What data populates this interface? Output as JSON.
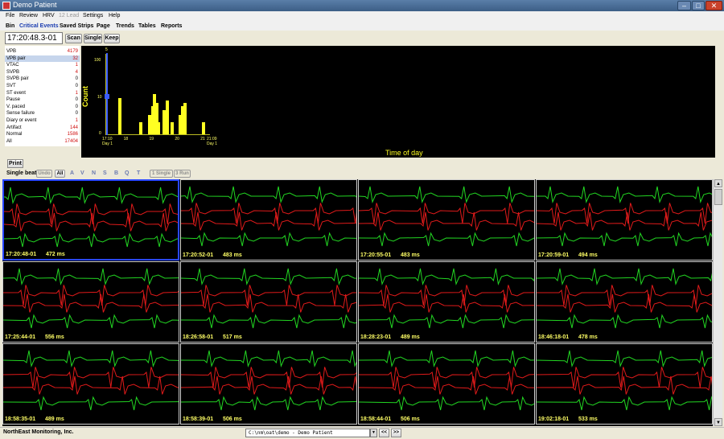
{
  "window": {
    "title": "Demo Patient"
  },
  "menu": [
    {
      "label": "File",
      "disabled": false
    },
    {
      "label": "Review",
      "disabled": false
    },
    {
      "label": "HRV",
      "disabled": false
    },
    {
      "label": "12 Lead",
      "disabled": true
    },
    {
      "label": "Settings",
      "disabled": false
    },
    {
      "label": "Help",
      "disabled": false
    }
  ],
  "tabs": [
    {
      "label": "Bin",
      "active": false
    },
    {
      "label": "Critical Events",
      "active": true
    },
    {
      "label": "Saved Strips",
      "active": false
    },
    {
      "label": "Page",
      "active": false
    },
    {
      "label": "Trends",
      "active": false
    },
    {
      "label": "Tables",
      "active": false
    },
    {
      "label": "Reports",
      "active": false
    }
  ],
  "toolbar": {
    "time_value": "17:20:48.3-01",
    "scan_label": "Scan",
    "single_label": "Single",
    "keep_label": "Keep"
  },
  "events": [
    {
      "label": "VPB",
      "count": "4179",
      "selected": false
    },
    {
      "label": "VPB pair",
      "count": "32",
      "selected": true
    },
    {
      "label": "VTAC",
      "count": "1",
      "selected": false
    },
    {
      "label": "SVPB",
      "count": "4",
      "selected": false
    },
    {
      "label": "SVPB pair",
      "count": "0",
      "selected": false
    },
    {
      "label": "SVT",
      "count": "0",
      "selected": false
    },
    {
      "label": "ST event",
      "count": "1",
      "selected": false
    },
    {
      "label": "Pause",
      "count": "0",
      "selected": false
    },
    {
      "label": "V. paced",
      "count": "0",
      "selected": false
    },
    {
      "label": "Sense failure",
      "count": "0",
      "selected": false
    },
    {
      "label": "Diary or event",
      "count": "1",
      "selected": false
    },
    {
      "label": "Artifact",
      "count": "144",
      "selected": false
    },
    {
      "label": "Normal",
      "count": "1586",
      "selected": false
    },
    {
      "label": "All",
      "count": "17404",
      "selected": false
    }
  ],
  "chart_data": {
    "type": "bar",
    "title": "",
    "xlabel": "Time of day",
    "ylabel": "Count",
    "marker_label": "5",
    "y_ticks": [
      "100",
      "10",
      "0"
    ],
    "x_ticks": [
      {
        "label": "17:10",
        "sub": "Day 1",
        "at": 0.0
      },
      {
        "label": "18",
        "sub": "",
        "at": 0.205
      },
      {
        "label": "19",
        "sub": "",
        "at": 0.45
      },
      {
        "label": "20",
        "sub": "",
        "at": 0.695
      },
      {
        "label": "21",
        "sub": "",
        "at": 0.94
      },
      {
        "label": "21:09",
        "sub": "Day 1",
        "at": 1.0
      }
    ],
    "bars": [
      {
        "x": 0.14,
        "value": 7
      },
      {
        "x": 0.335,
        "value": 1
      },
      {
        "x": 0.42,
        "value": 2
      },
      {
        "x": 0.45,
        "value": 4
      },
      {
        "x": 0.47,
        "value": 9
      },
      {
        "x": 0.49,
        "value": 5
      },
      {
        "x": 0.51,
        "value": 1
      },
      {
        "x": 0.565,
        "value": 3
      },
      {
        "x": 0.59,
        "value": 6
      },
      {
        "x": 0.635,
        "value": 1
      },
      {
        "x": 0.715,
        "value": 2
      },
      {
        "x": 0.74,
        "value": 4
      },
      {
        "x": 0.765,
        "value": 5
      },
      {
        "x": 0.94,
        "value": 1
      }
    ]
  },
  "print_label": "Print",
  "filters": {
    "label": "Single beat",
    "undo": "Undo",
    "all": "All",
    "letters": [
      "A",
      "V",
      "N",
      "S",
      "B",
      "Q",
      "T"
    ],
    "one_single": "1 Single",
    "three_run": "3 Run"
  },
  "strips": [
    {
      "time": "17:20:48-01",
      "ms": "472 ms",
      "selected": true
    },
    {
      "time": "17:20:52-01",
      "ms": "483 ms",
      "selected": false
    },
    {
      "time": "17:20:55-01",
      "ms": "483 ms",
      "selected": false
    },
    {
      "time": "17:20:59-01",
      "ms": "494 ms",
      "selected": false
    },
    {
      "time": "17:25:44-01",
      "ms": "556 ms",
      "selected": false
    },
    {
      "time": "18:26:58-01",
      "ms": "517 ms",
      "selected": false
    },
    {
      "time": "18:28:23-01",
      "ms": "489 ms",
      "selected": false
    },
    {
      "time": "18:46:18-01",
      "ms": "478 ms",
      "selected": false
    },
    {
      "time": "18:58:35-01",
      "ms": "489 ms",
      "selected": false
    },
    {
      "time": "18:58:39-01",
      "ms": "506 ms",
      "selected": false
    },
    {
      "time": "18:58:44-01",
      "ms": "506 ms",
      "selected": false
    },
    {
      "time": "19:02:18-01",
      "ms": "533 ms",
      "selected": false
    }
  ],
  "colors": {
    "trace_red": "#e01a1a",
    "trace_green": "#22d622",
    "chart_bar": "#ffff22",
    "accent_blue": "#2a48ff"
  },
  "status": {
    "company": "NorthEast Monitoring, Inc.",
    "path": "C:\\nm\\oat\\demo - Demo Patient",
    "prev": "<<",
    "next": ">>"
  }
}
